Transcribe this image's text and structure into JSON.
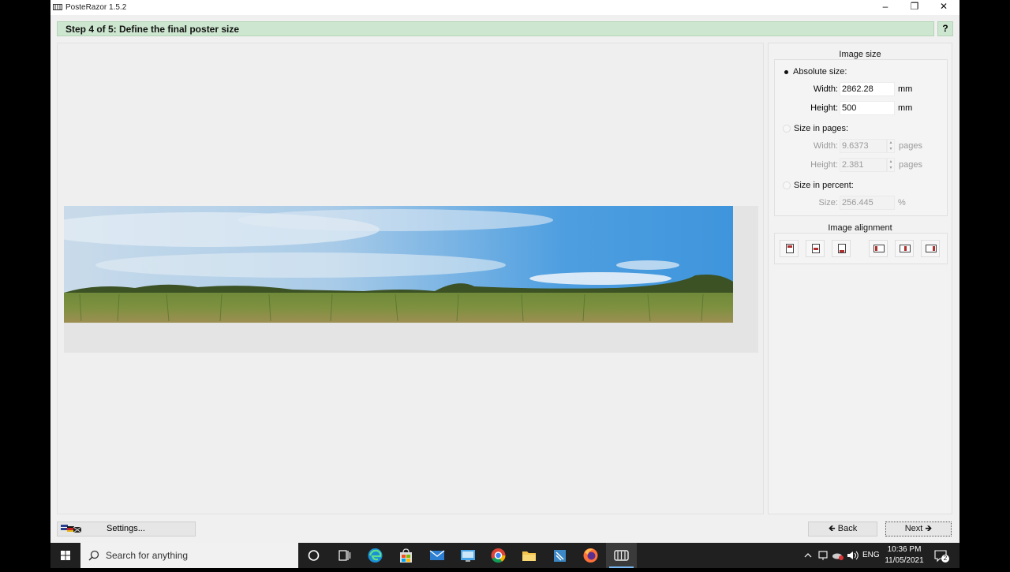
{
  "window": {
    "title": "PosteRazor 1.5.2",
    "minimize_label": "–",
    "maximize_label": "❐",
    "close_label": "✕"
  },
  "step": {
    "title": "Step 4 of 5: Define the final poster size",
    "help_label": "?"
  },
  "image_size": {
    "title": "Image size",
    "absolute": {
      "label": "Absolute size:",
      "selected": true,
      "width_label": "Width:",
      "width_value": "2862.28",
      "width_unit": "mm",
      "height_label": "Height:",
      "height_value": "500",
      "height_unit": "mm"
    },
    "pages": {
      "label": "Size in pages:",
      "selected": false,
      "width_label": "Width:",
      "width_value": "9.6373",
      "width_unit": "pages",
      "height_label": "Height:",
      "height_value": "2.381",
      "height_unit": "pages"
    },
    "percent": {
      "label": "Size in percent:",
      "selected": false,
      "size_label": "Size:",
      "size_value": "256.445",
      "size_unit": "%"
    }
  },
  "image_alignment": {
    "title": "Image alignment",
    "buttons": [
      "align-top",
      "align-vcenter",
      "align-bottom",
      "align-left",
      "align-hcenter",
      "align-right"
    ]
  },
  "footer": {
    "settings_label": "Settings...",
    "back_label": "Back",
    "next_label": "Next"
  },
  "taskbar": {
    "search_placeholder": "Search for anything",
    "language": "ENG",
    "time": "10:36 PM",
    "date": "11/05/2021",
    "notification_count": "2"
  },
  "colors": {
    "step_bar": "#cde6cf",
    "alignment_accent": "#b0302e",
    "taskbar": "#202020"
  }
}
